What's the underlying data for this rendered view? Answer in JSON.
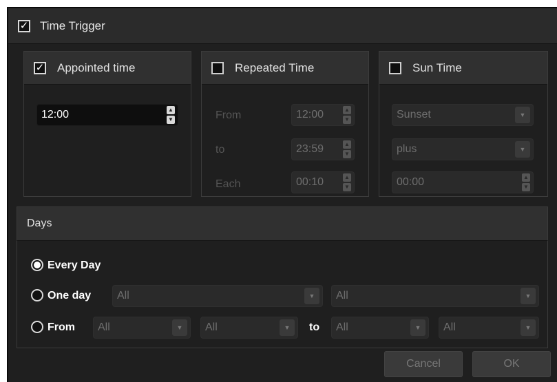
{
  "title": "Time Trigger",
  "title_checked": true,
  "appointed": {
    "label": "Appointed time",
    "checked": true,
    "time": "12:00"
  },
  "repeated": {
    "label": "Repeated Time",
    "checked": false,
    "from_label": "From",
    "from_value": "12:00",
    "to_label": "to",
    "to_value": "23:59",
    "each_label": "Each",
    "each_value": "00:10"
  },
  "sun": {
    "label": "Sun Time",
    "checked": false,
    "event": "Sunset",
    "offset_mode": "plus",
    "offset": "00:00"
  },
  "days": {
    "label": "Days",
    "every_day": "Every Day",
    "one_day": "One day",
    "one_day_select1": "All",
    "one_day_select2": "All",
    "from": "From",
    "from_select1": "All",
    "from_select2": "All",
    "to": "to",
    "to_select1": "All",
    "to_select2": "All",
    "selected": "every_day"
  },
  "buttons": {
    "cancel": "Cancel",
    "ok": "OK"
  }
}
